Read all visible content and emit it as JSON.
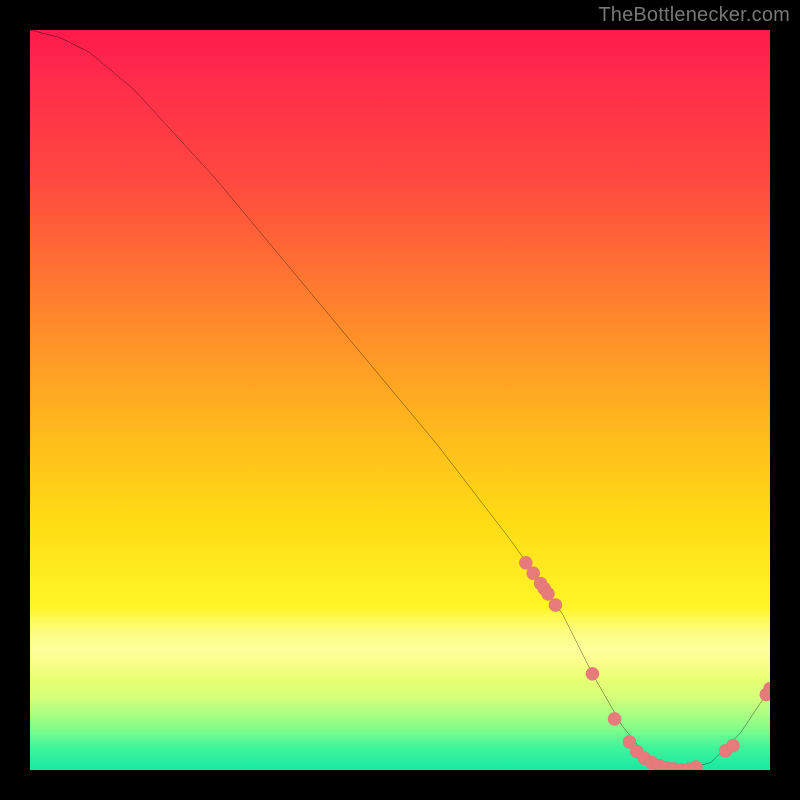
{
  "watermark": "TheBottlenecker.com",
  "colors": {
    "line": "#000000",
    "marker_fill": "#e77b7b",
    "marker_stroke": "#c65a5a"
  },
  "chart_data": {
    "type": "line",
    "title": "",
    "xlabel": "",
    "ylabel": "",
    "xlim": [
      0,
      100
    ],
    "ylim": [
      0,
      100
    ],
    "x": [
      0,
      4,
      8,
      14,
      25,
      40,
      55,
      65,
      72,
      76,
      80,
      84,
      88,
      92,
      96,
      100
    ],
    "values": [
      100,
      99,
      97,
      92,
      80,
      62,
      44,
      31,
      21,
      13,
      6,
      1,
      0,
      1,
      5,
      11
    ],
    "series": [
      {
        "name": "cluster-markers",
        "type": "scatter",
        "x": [
          67,
          68,
          69,
          69.5,
          70,
          71,
          76,
          79,
          81,
          82,
          83,
          84,
          85,
          86,
          87,
          88,
          89,
          90,
          94,
          95,
          99.5,
          100
        ],
        "values": [
          28.0,
          26.6,
          25.2,
          24.5,
          23.8,
          22.3,
          13.0,
          6.9,
          3.8,
          2.5,
          1.6,
          1.0,
          0.6,
          0.3,
          0.15,
          0.0,
          0.1,
          0.4,
          2.6,
          3.3,
          10.2,
          11.0
        ]
      }
    ]
  }
}
